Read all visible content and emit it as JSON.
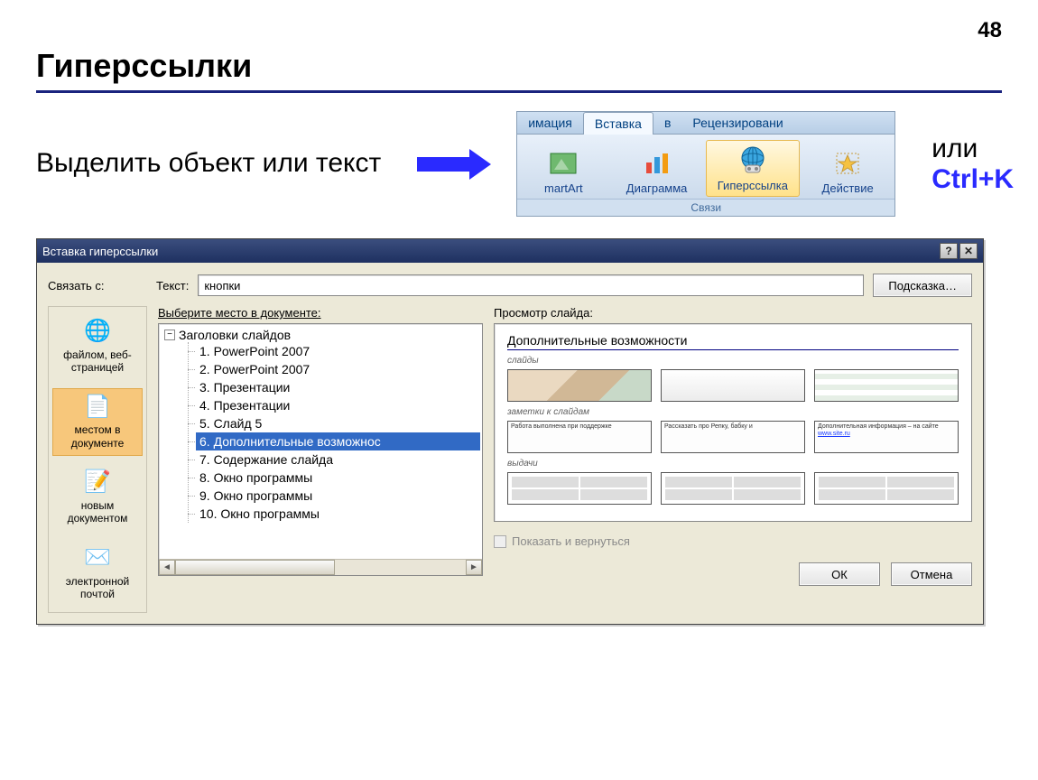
{
  "page_number": "48",
  "title": "Гиперссылки",
  "intro_text": "Выделить объект или текст",
  "ribbon": {
    "tabs": [
      "имация",
      "Вставка",
      "в",
      "Рецензировани"
    ],
    "active_index": 1,
    "buttons": [
      {
        "label": "martArt"
      },
      {
        "label": "Диаграмма"
      },
      {
        "label": "Гиперссылка"
      },
      {
        "label": "Действие"
      }
    ],
    "highlight_index": 2,
    "group_label": "Связи"
  },
  "shortcut_prefix": "или ",
  "shortcut_key": "Ctrl+K",
  "dialog": {
    "title": "Вставка гиперссылки",
    "link_to_label": "Связать с:",
    "text_label": "Текст:",
    "text_value": "кнопки",
    "hint_button": "Подсказка…",
    "sidebar": [
      "файлом, веб-страницей",
      "местом в документе",
      "новым документом",
      "электронной почтой"
    ],
    "sidebar_selected": 1,
    "choose_label": "Выберите место в документе:",
    "tree_root": "Заголовки слайдов",
    "tree_items": [
      "1. PowerPoint 2007",
      "2. PowerPoint 2007",
      "3. Презентации",
      "4. Презентации",
      "5. Слайд 5",
      "6. Дополнительные возможнос",
      "7. Содержание слайда",
      "8. Окно программы",
      "9. Окно программы",
      "10. Окно программы"
    ],
    "tree_selected": 5,
    "preview_label": "Просмотр слайда:",
    "preview": {
      "title": "Дополнительные возможности",
      "section_slides": "слайды",
      "section_notes": "заметки к слайдам",
      "note1": "Работа выполнена при поддержке",
      "note2": "Рассказать про Репку, бабку и",
      "note3_a": "Дополнительная информация – на сайте",
      "note3_b": "www.site.ru",
      "section_handouts": "выдачи"
    },
    "show_return": "Показать и вернуться",
    "ok": "ОК",
    "cancel": "Отмена"
  }
}
